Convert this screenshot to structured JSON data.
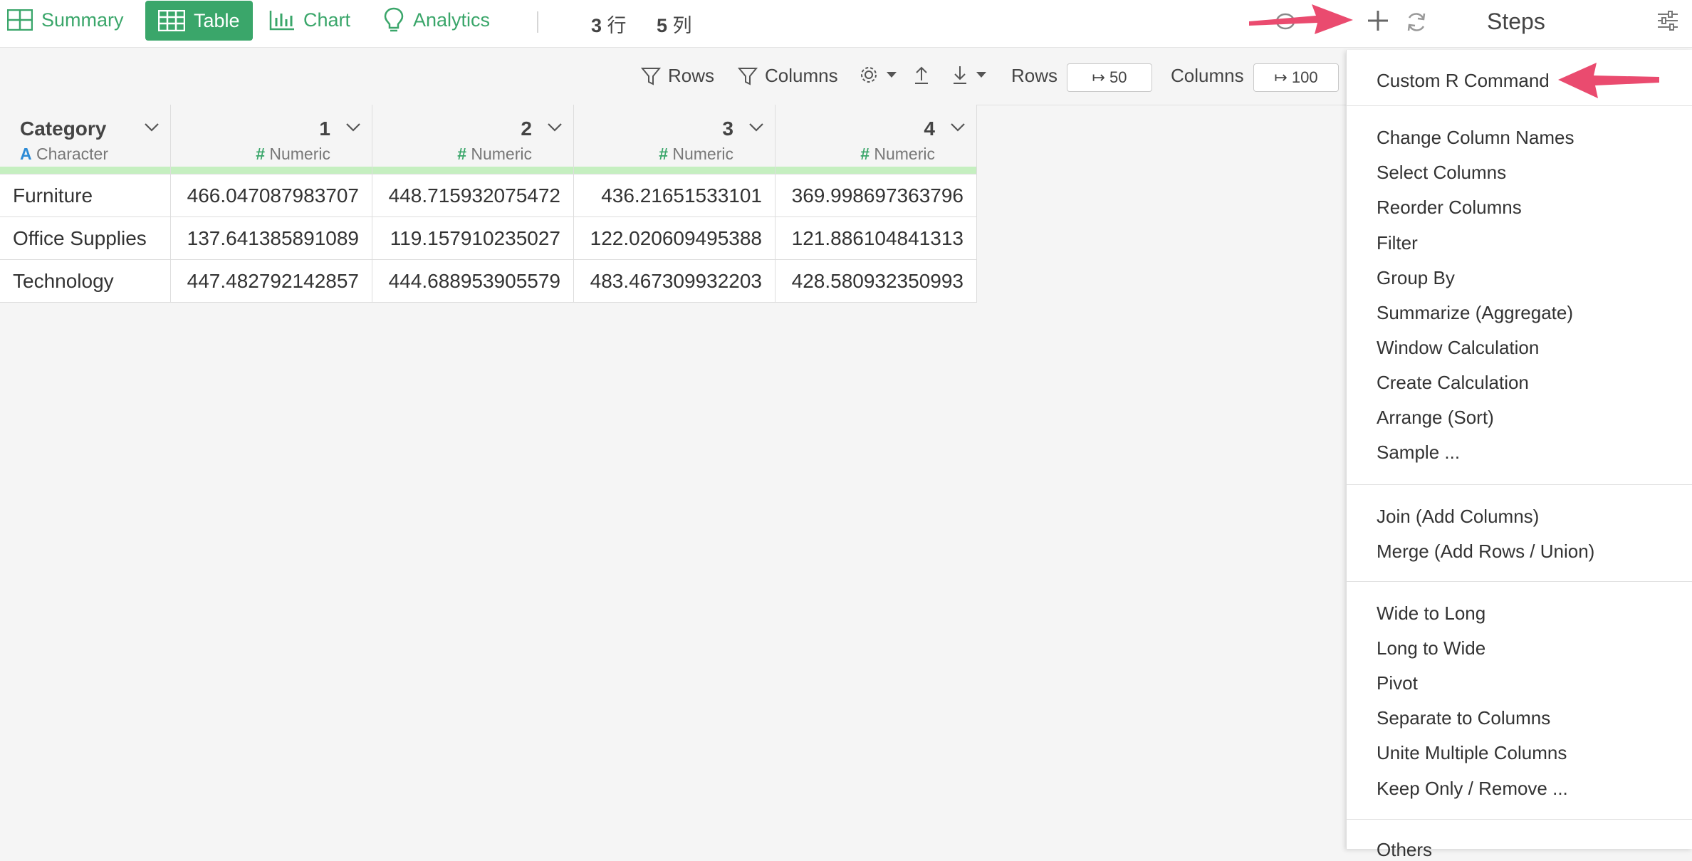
{
  "view_tabs": [
    {
      "label": "Summary",
      "icon": "grid-icon"
    },
    {
      "label": "Table",
      "icon": "table-icon"
    },
    {
      "label": "Chart",
      "icon": "bar-chart-icon"
    },
    {
      "label": "Analytics",
      "icon": "lightbulb-icon"
    }
  ],
  "counts": {
    "rows_num": "3",
    "rows_unit": "行",
    "cols_num": "5",
    "cols_unit": "列"
  },
  "toolbar": {
    "rows_filter": "Rows",
    "columns_filter": "Columns",
    "rows_label": "Rows",
    "rows_value": "↦ 50",
    "columns_label": "Columns",
    "columns_value": "↦ 100"
  },
  "steps_title": "Steps",
  "table": {
    "columns": [
      {
        "name": "Category",
        "type_glyph": "A",
        "type": "Character"
      },
      {
        "name": "1",
        "type_glyph": "#",
        "type": "Numeric"
      },
      {
        "name": "2",
        "type_glyph": "#",
        "type": "Numeric"
      },
      {
        "name": "3",
        "type_glyph": "#",
        "type": "Numeric"
      },
      {
        "name": "4",
        "type_glyph": "#",
        "type": "Numeric"
      }
    ],
    "rows": [
      [
        "Furniture",
        "466.047087983707",
        "448.715932075472",
        "436.21651533101",
        "369.998697363796"
      ],
      [
        "Office Supplies",
        "137.641385891089",
        "119.157910235027",
        "122.020609495388",
        "121.886104841313"
      ],
      [
        "Technology",
        "447.482792142857",
        "444.688953905579",
        "483.467309932203",
        "428.580932350993"
      ]
    ]
  },
  "menu": {
    "group1": [
      "Custom R Command"
    ],
    "group2": [
      "Change Column Names",
      "Select Columns",
      "Reorder Columns",
      "Filter",
      "Group By",
      "Summarize (Aggregate)",
      "Window Calculation",
      "Create Calculation",
      "Arrange (Sort)",
      "Sample ..."
    ],
    "group3": [
      "Join (Add Columns)",
      "Merge (Add Rows / Union)"
    ],
    "group4": [
      "Wide to Long",
      "Long to Wide",
      "Pivot",
      "Separate to Columns",
      "Unite Multiple Columns",
      "Keep Only / Remove ..."
    ],
    "group5": [
      "Others"
    ]
  },
  "colors": {
    "accent": "#3aa66a",
    "arrow": "#ea4b6f",
    "quality_bar": "#c5efc0",
    "character_type": "#2d8bd6"
  }
}
